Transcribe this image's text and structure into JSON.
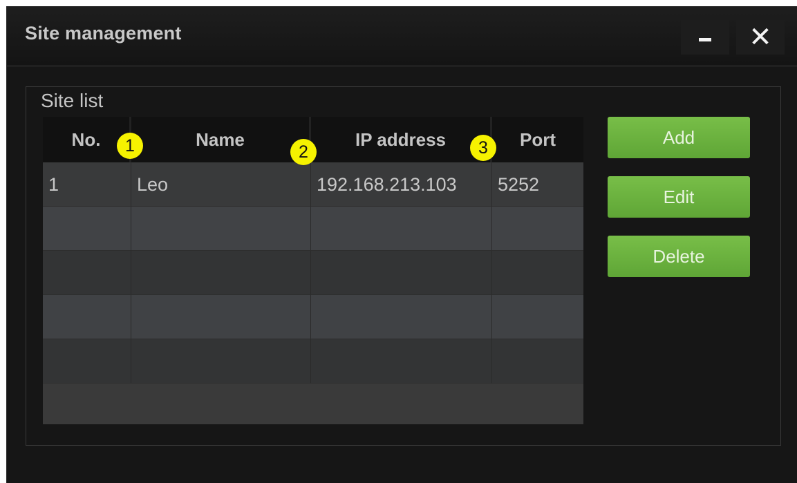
{
  "window": {
    "title": "Site management",
    "minimize_symbol": "–",
    "close_symbol": "✕"
  },
  "site_list": {
    "label": "Site list",
    "columns": [
      "No.",
      "Name",
      "IP address",
      "Port"
    ],
    "rows": [
      [
        "1",
        "Leo",
        "192.168.213.103",
        "5252"
      ],
      [
        "",
        "",
        "",
        ""
      ],
      [
        "",
        "",
        "",
        ""
      ],
      [
        "",
        "",
        "",
        ""
      ],
      [
        "",
        "",
        "",
        ""
      ]
    ]
  },
  "callouts": [
    "1",
    "2",
    "3"
  ],
  "buttons": {
    "add": "Add",
    "edit": "Edit",
    "delete": "Delete"
  },
  "colors": {
    "button_green": "#6cb33f",
    "callout_yellow": "#f6f200",
    "window_bg": "#161616"
  }
}
